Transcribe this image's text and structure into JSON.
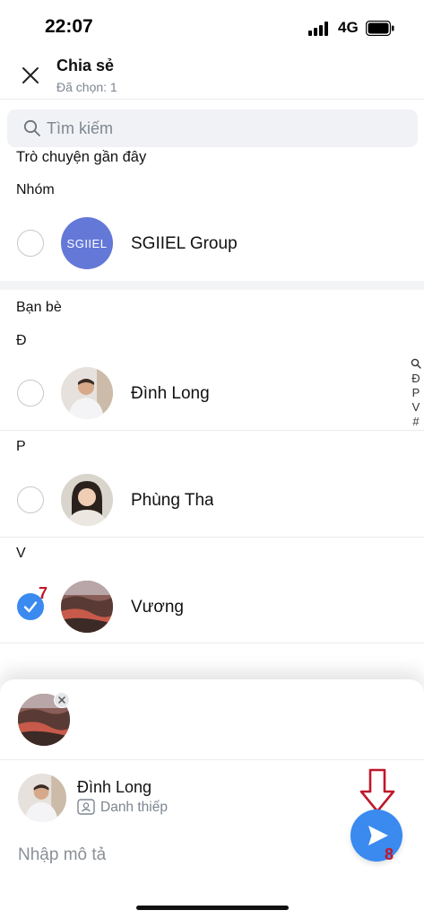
{
  "status_bar": {
    "time": "22:07",
    "network": "4G"
  },
  "header": {
    "title": "Chia sẻ",
    "subtitle": "Đã chọn: 1"
  },
  "search": {
    "placeholder": "Tìm kiếm"
  },
  "sections": {
    "recent": "Trò chuyện gần đây",
    "groups_label": "Nhóm",
    "friends": "Bạn bè"
  },
  "groups": [
    {
      "name": "SGIIEL Group",
      "avatar_text": "SGIIEL",
      "avatar_color": "#6478d8",
      "checked": false
    }
  ],
  "friends": [
    {
      "letter": "Đ",
      "name": "Đình Long",
      "checked": false
    },
    {
      "letter": "P",
      "name": "Phùng Tha",
      "checked": false
    },
    {
      "letter": "V",
      "name": "Vương",
      "checked": true
    }
  ],
  "index_letters": [
    "Đ",
    "P",
    "V",
    "#"
  ],
  "annotations": {
    "step_select": "7",
    "step_send": "8"
  },
  "sheet": {
    "card_name": "Đình Long",
    "card_subtitle": "Danh thiếp",
    "description_placeholder": "Nhập mô tả"
  },
  "colors": {
    "accent": "#3a8af0",
    "annotation": "#c0172a"
  }
}
